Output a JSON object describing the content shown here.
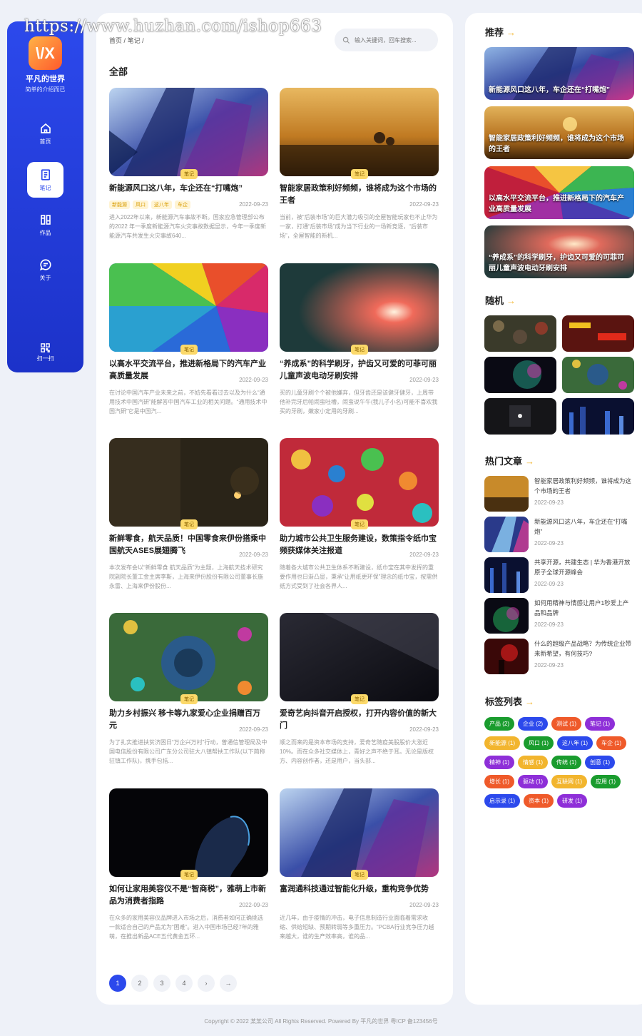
{
  "watermark": "https://www.huzhan.com/ishop663",
  "sidebar": {
    "logo_text": "\\/X",
    "site_name": "平凡的世界",
    "site_sub": "简单的介绍而已",
    "items": [
      {
        "label": "首页",
        "icon": "home-icon"
      },
      {
        "label": "笔记",
        "icon": "notebook-icon"
      },
      {
        "label": "作品",
        "icon": "works-icon"
      },
      {
        "label": "关于",
        "icon": "chat-icon"
      }
    ],
    "scan_label": "扫一扫"
  },
  "breadcrumb": {
    "home": "首页",
    "sep": "/",
    "current": "笔记",
    "sep2": "/"
  },
  "search": {
    "placeholder": "输入关键词，回车搜索..."
  },
  "section_title": "全部",
  "cards": [
    {
      "title": "新能源风口这八年，车企还在“打嘴炮”",
      "badge": "笔记",
      "date": "2022-09-23",
      "tags": [
        "新能源",
        "风口",
        "这八年",
        "车企"
      ],
      "excerpt": "进入2022年以来，新能源汽车事故不断。国家应急管理部公布的2022 年一季度新能源汽车火灾事故数据显示，今年一季度新能源汽车共发生火灾事故640..."
    },
    {
      "title": "智能家居政策利好频频，谁将成为这个市场的王者",
      "badge": "笔记",
      "date": "2022-09-23",
      "tags": [],
      "excerpt": "当前，被“后装市场”的巨大潜力吸引的全屋智能玩家也不止华为一家，打通“后装市场”成为当下行业的一场新竞逐，“后装市场”，全屋智能的新机..."
    },
    {
      "title": "以高水平交流平台，推进新格局下的汽车产业高质量发展",
      "badge": "笔记",
      "date": "2022-09-23",
      "tags": [],
      "excerpt": "在讨论中国汽车产业未来之前，不妨先看看过去以及为什么“通用技术中国汽研”能解答中国汽车工业的相关问题。“通用技术中国汽研”它是中国汽..."
    },
    {
      "title": "“养成系”的科学刷牙，护齿又可爱的可菲可丽儿童声波电动牙刷安排",
      "badge": "笔记",
      "date": "2022-09-23",
      "tags": [],
      "excerpt": "买的儿童牙刷个个被他嫌弃，但牙齿还是该健牙健牙，上周带他补完牙后帕闹蛮吐槽，闹蛮说午午(我儿子小名)可能不喜欢我买的牙刷，嫩家小定用的牙刷..."
    },
    {
      "title": "新鲜零食，航天品质！中国零食来伊份搭乘中国航天ASES展翅腾飞",
      "badge": "笔记",
      "date": "2022-09-23",
      "tags": [],
      "excerpt": "本次发布会以“新鲜零食 航天品质”为主题，上海航天技术研究院副院长董工金主席李斯，上海来伊份股份有限公司董事长施永雷、上海来伊份股份..."
    },
    {
      "title": "助力城市公共卫生服务建设，数策指令纸巾宝频获媒体关注报道",
      "badge": "笔记",
      "date": "2022-09-23",
      "tags": [],
      "excerpt": "随着各大城市公共卫生体系不断建设，纸巾宝在其中发挥的重要作用也日渐凸显，秉承“让用纸更环保”理念的纸巾宝，按需供纸方式受到了社会各界人..."
    },
    {
      "title": "助力乡村振兴 移卡等九家爱心企业捐赠百万元",
      "badge": "笔记",
      "date": "2022-09-23",
      "tags": [],
      "excerpt": "为了扎实推进扶贫济困日“万企兴万村”行动，曾通信管理局及中国电信股份有限公司广东分公司驻大八镇帮扶工作队(以下简称驻镇工作队)，携手包括..."
    },
    {
      "title": "爱奇艺向抖音开启授权，打开内容价值的新大门",
      "badge": "笔记",
      "date": "2022-09-23",
      "tags": [],
      "excerpt": "顺之而来的是资本市场的支持，爱奇艺随疫美股股价大涨近10%。而在众多社交媒体上，青好之声不绝于耳。无论是版权方、内容创作者，还是用户，当头部..."
    },
    {
      "title": "如何让家用美容仪不是“智商税”，雅萌上市新品为消费者指路",
      "badge": "笔记",
      "date": "2022-09-23",
      "tags": [],
      "excerpt": "在众多的家用美容仪品牌进入市场之后，消费者如何正确挑选一款适合自己的产品尤为“困难”。进入中国市场已经7年的雅萌，在推出新品ACE五代黄金五环..."
    },
    {
      "title": "富润通科技通过智能化升级，重构竞争优势",
      "badge": "笔记",
      "date": "2022-09-23",
      "tags": [],
      "excerpt": "近几年，由于疫情的冲击，电子信息制造行业面临着需求收缩、供给短缺、预期转弱等多重压力。“PCBA行业竞争压力越来越大，谁的生产效率高，谁的品..."
    }
  ],
  "pager": [
    "1",
    "2",
    "3",
    "4",
    "›",
    "→"
  ],
  "right": {
    "rec_title": "推荐",
    "arrow": "→",
    "recs": [
      "新能源风口这八年，车企还在“打嘴炮”",
      "智能家居政策利好频频，谁将成为这个市场的王者",
      "以高水平交流平台，推进新格局下的汽车产业高质量发展",
      "“养成系”的科学刷牙，护齿又可爱的可菲可丽儿童声波电动牙刷安排"
    ],
    "random_title": "随机",
    "hot_title": "热门文章",
    "hots": [
      {
        "title": "智能家居政策利好频频，谁将成为这个市场的王者",
        "date": "2022-09-23"
      },
      {
        "title": "新能源风口这八年，车企还在“打嘴炮”",
        "date": "2022-09-23"
      },
      {
        "title": "共享开源，共建生态 | 华为香港开放原子全球开源峰会",
        "date": "2022-09-23"
      },
      {
        "title": "如何用精神与情感让用户1秒爱上产品和品牌",
        "date": "2022-09-23"
      },
      {
        "title": "什么的超级产品战略？为传统企业带来新希望，有何技巧?",
        "date": "2022-09-23"
      }
    ],
    "tags_title": "标签列表",
    "tags": [
      {
        "label": "产品 (2)",
        "color": "#1a9c2e"
      },
      {
        "label": "企业 (2)",
        "color": "#2c49ec"
      },
      {
        "label": "测试 (1)",
        "color": "#ef5a2a"
      },
      {
        "label": "笔记 (1)",
        "color": "#8e2fd8"
      },
      {
        "label": "新能源 (1)",
        "color": "#f2b52e"
      },
      {
        "label": "风口 (1)",
        "color": "#1a9c2e"
      },
      {
        "label": "这八年 (1)",
        "color": "#2c49ec"
      },
      {
        "label": "车企 (1)",
        "color": "#ef5a2a"
      },
      {
        "label": "精神 (1)",
        "color": "#8e2fd8"
      },
      {
        "label": "情感 (1)",
        "color": "#f2b52e"
      },
      {
        "label": "传统 (1)",
        "color": "#1a9c2e"
      },
      {
        "label": "创意 (1)",
        "color": "#2c49ec"
      },
      {
        "label": "增长 (1)",
        "color": "#ef5a2a"
      },
      {
        "label": "驱动 (1)",
        "color": "#8e2fd8"
      },
      {
        "label": "互联网 (1)",
        "color": "#f2b52e"
      },
      {
        "label": "应用 (1)",
        "color": "#1a9c2e"
      },
      {
        "label": "启示录 (1)",
        "color": "#2c49ec"
      },
      {
        "label": "资本 (1)",
        "color": "#ef5a2a"
      },
      {
        "label": "研发 (1)",
        "color": "#8e2fd8"
      }
    ]
  },
  "footer": "Copyright © 2022 某某公司 All Rights Reserved. Powered By 平凡的世界 粤ICP 备123456号",
  "colors": {
    "accent": "#2c49ec",
    "badge": "#fcd96a",
    "arrow": "#f2b52e"
  }
}
